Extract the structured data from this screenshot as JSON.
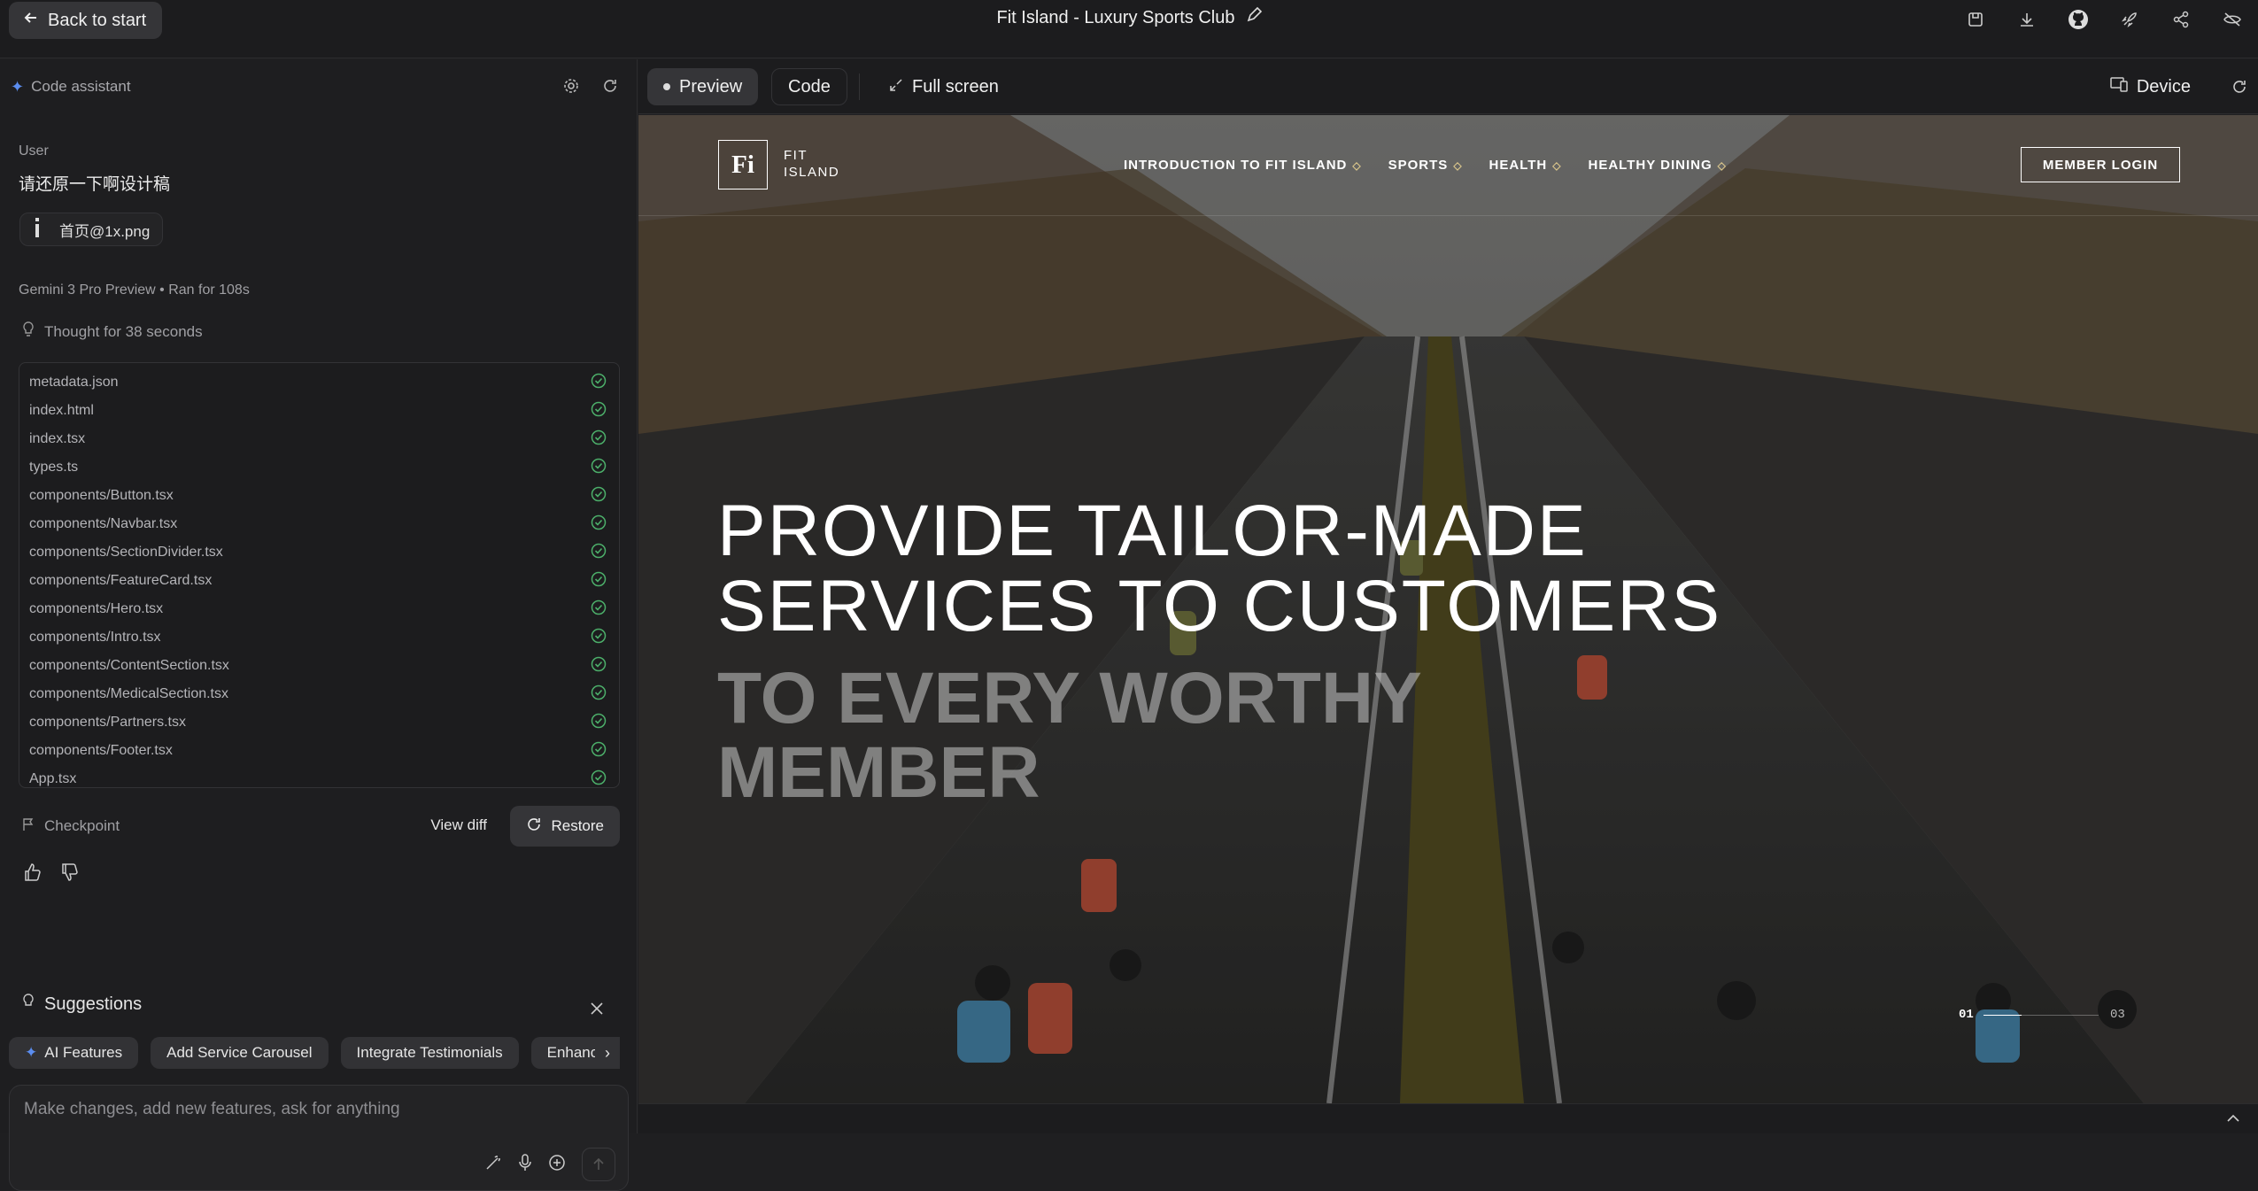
{
  "topbar": {
    "back_label": "Back to start",
    "app_title": "Fit Island - Luxury Sports Club",
    "icons": [
      "save-icon",
      "download-icon",
      "github-icon",
      "deploy-icon",
      "share-icon",
      "hide-icon"
    ]
  },
  "assistant": {
    "header": "Code assistant",
    "user_label": "User",
    "user_message": "请还原一下啊设计稿",
    "attachment": "首页@1x.png",
    "model": "Gemini 3 Pro Preview",
    "ran_for": "Ran for 108s",
    "thought": "Thought for 38 seconds",
    "files": [
      "metadata.json",
      "index.html",
      "index.tsx",
      "types.ts",
      "components/Button.tsx",
      "components/Navbar.tsx",
      "components/SectionDivider.tsx",
      "components/FeatureCard.tsx",
      "components/Hero.tsx",
      "components/Intro.tsx",
      "components/ContentSection.tsx",
      "components/MedicalSection.tsx",
      "components/Partners.tsx",
      "components/Footer.tsx",
      "App.tsx"
    ],
    "checkpoint_label": "Checkpoint",
    "view_diff": "View diff",
    "restore": "Restore",
    "suggestions_title": "Suggestions",
    "suggestions": [
      "AI Features",
      "Add Service Carousel",
      "Integrate Testimonials",
      "Enhance"
    ],
    "prompt_placeholder": "Make changes, add new features, ask for anything"
  },
  "toolbar": {
    "preview": "Preview",
    "code": "Code",
    "fullscreen": "Full screen",
    "device": "Device"
  },
  "site": {
    "logo_mark": "Fi",
    "logo_line1": "FIT",
    "logo_line2": "ISLAND",
    "nav": [
      "INTRODUCTION TO FIT ISLAND",
      "SPORTS",
      "HEALTH",
      "HEALTHY DINING"
    ],
    "login": "MEMBER LOGIN",
    "hero_line1": "PROVIDE TAILOR-MADE",
    "hero_line2": "SERVICES TO CUSTOMERS",
    "hero_sub1": "TO EVERY WORTHY",
    "hero_sub2": "MEMBER",
    "slide_current": "01",
    "slide_total": "03",
    "slide_progress": 0.33
  },
  "colors": {
    "accent": "#5b8def",
    "check": "#4caf6a",
    "nav_diamond": "#d8c48a"
  }
}
